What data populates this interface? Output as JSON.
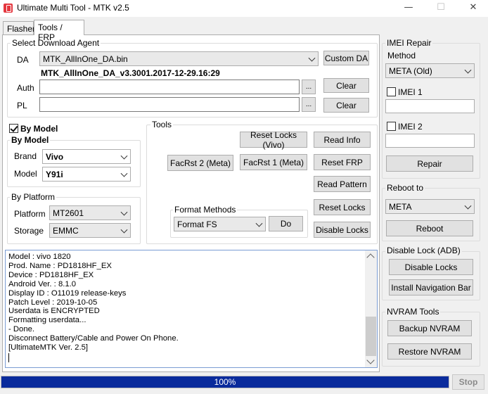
{
  "window": {
    "title": "Ultimate Multi Tool - MTK v2.5",
    "minimize": "—",
    "maximize": "☐",
    "close": "✕"
  },
  "tabs": [
    {
      "label": "Flasher",
      "active": false
    },
    {
      "label": "Tools / FRP",
      "active": true
    }
  ],
  "download_agent": {
    "group_label": "Select Download Agent",
    "da_label": "DA",
    "da_value": "MTK_AllInOne_DA.bin",
    "custom_da_button": "Custom DA",
    "da_info": "MTK_AllInOne_DA_v3.3001.2017-12-29.16:29",
    "auth_label": "Auth",
    "auth_value": "",
    "auth_browse": "...",
    "auth_clear": "Clear",
    "pl_label": "PL",
    "pl_value": "",
    "pl_browse": "...",
    "pl_clear": "Clear"
  },
  "by_model": {
    "checkbox_label": "By Model",
    "checked": true,
    "group_label": "By Model",
    "brand_label": "Brand",
    "brand_value": "Vivo",
    "model_label": "Model",
    "model_value": "Y91i"
  },
  "by_platform": {
    "group_label": "By Platform",
    "platform_label": "Platform",
    "platform_value": "MT2601",
    "storage_label": "Storage",
    "storage_value": "EMMC"
  },
  "tools": {
    "group_label": "Tools",
    "reset_locks_vivo": "Reset Locks (Vivo)",
    "read_info": "Read Info",
    "facrst2_meta": "FacRst 2 (Meta)",
    "facrst1_meta": "FacRst 1 (Meta)",
    "reset_frp": "Reset FRP",
    "read_pattern": "Read Pattern",
    "reset_locks": "Reset Locks",
    "disable_locks": "Disable Locks",
    "format_methods_label": "Format Methods",
    "format_value": "Format FS",
    "do_button": "Do"
  },
  "log": {
    "lines": "Model : vivo 1820\nProd. Name : PD1818HF_EX\nDevice : PD1818HF_EX\nAndroid Ver. : 8.1.0\nDisplay ID : O11019 release-keys\nPatch Level : 2019-10-05\nUserdata is ENCRYPTED\nFormatting userdata...\n- Done.\nDisconnect Battery/Cable and Power On Phone.\n[UltimateMTK Ver. 2.5]"
  },
  "imei_repair": {
    "group_label": "IMEI Repair",
    "method_label": "Method",
    "method_value": "META (Old)",
    "imei1_label": "IMEI 1",
    "imei1_checked": false,
    "imei1_value": "",
    "imei2_label": "IMEI 2",
    "imei2_checked": false,
    "imei2_value": "",
    "repair_button": "Repair"
  },
  "reboot": {
    "group_label": "Reboot to",
    "mode_value": "META",
    "reboot_button": "Reboot"
  },
  "disable_lock": {
    "group_label": "Disable Lock (ADB)",
    "disable_locks_button": "Disable Locks",
    "install_nav_button": "Install Navigation Bar"
  },
  "nvram": {
    "group_label": "NVRAM Tools",
    "backup_button": "Backup NVRAM",
    "restore_button": "Restore NVRAM"
  },
  "progress": {
    "value": 100,
    "label": "100%",
    "stop_button": "Stop"
  },
  "colors": {
    "progress_fill": "#0a2b9c",
    "log_border": "#7a9cd3"
  }
}
